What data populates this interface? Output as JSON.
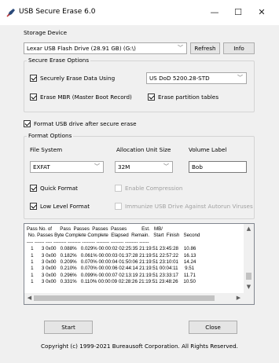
{
  "window": {
    "title": "USB Secure Erase 6.0",
    "minimize": "—",
    "maximize": "☐",
    "close": "✕"
  },
  "storage": {
    "label": "Storage Device",
    "device": "Lexar USB Flash Drive (28.91 GB) (G:\\)",
    "refresh": "Refresh",
    "info": "Info"
  },
  "secure_erase_options": {
    "title": "Secure Erase Options",
    "securely_erase": {
      "label": "Securely Erase Data Using",
      "checked": true
    },
    "method": "US DoD 5200.28-STD",
    "erase_mbr": {
      "label": "Erase MBR (Master Boot Record)",
      "checked": true
    },
    "erase_partition_tables": {
      "label": "Erase partition tables",
      "checked": true
    }
  },
  "format_after": {
    "label": "Format USB drive after secure erase",
    "checked": true
  },
  "format_options": {
    "title": "Format Options",
    "file_system_label": "File System",
    "allocation_label": "Allocation Unit Size",
    "volume_label_label": "Volume Label",
    "file_system": "EXFAT",
    "allocation": "32M",
    "volume_label": "Bob",
    "quick_format": {
      "label": "Quick Format",
      "checked": true
    },
    "enable_compression": {
      "label": "Enable Compression",
      "checked": false
    },
    "low_level_format": {
      "label": "Low Level Format",
      "checked": true
    },
    "immunize": {
      "label": "Immunize USB Drive Against Autorun Viruses",
      "checked": false
    }
  },
  "log": {
    "header1": "Pass No. of      Pass  Passes  Passes  Passes           Est.   MB/",
    "header2": " No. Passes Byte Complete Complete  Elapsed  Remain.   Start  Finish   Second",
    "separator": "---- ------ ---- -------- -------- -------- -------- -------- -------- ------",
    "rows": [
      "   1      3 0x00   0.088%   0.029% 00:00:02 02:25:35 21:19:51 23:45:28    10.86",
      "   1      3 0x00   0.182%   0.061% 00:00:03 01:37:28 21:19:51 22:57:22    16.13",
      "   1      3 0x00   0.209%   0.070% 00:00:04 01:50:06 21:19:51 23:10:01    14.24",
      "   1      3 0x00   0.210%   0.070% 00:00:06 02:44:14 21:19:51 00:04:11     9.51",
      "   1      3 0x00   0.296%   0.099% 00:00:07 02:13:19 21:19:51 23:33:17    11.71",
      "   1      3 0x00   0.331%   0.110% 00:00:09 02:28:26 21:19:51 23:48:26    10.50"
    ]
  },
  "buttons": {
    "start": "Start",
    "close": "Close"
  },
  "copyright": "Copyright (c) 1999-2021 Bureausoft Corporation. All Rights Reserved."
}
